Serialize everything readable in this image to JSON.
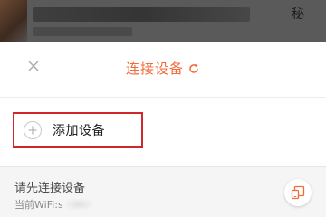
{
  "background": {
    "title_suffix": "秘"
  },
  "sheet": {
    "title": "连接设备",
    "accent_color": "#f26b3a",
    "close_icon": "close-icon",
    "refresh_icon": "refresh-icon"
  },
  "add_device": {
    "label": "添加设备",
    "icon": "plus-circle-icon",
    "highlight_color": "#d0282a"
  },
  "footer": {
    "prompt": "请先连接设备",
    "wifi_label": "当前WiFi:s",
    "device_icon": "device-screen-icon"
  }
}
